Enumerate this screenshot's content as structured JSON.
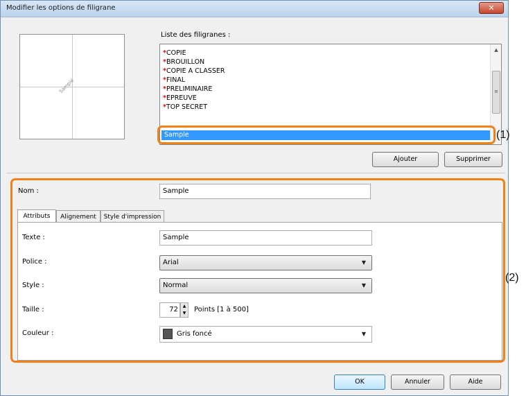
{
  "window": {
    "title": "Modifier les options de filigrane",
    "close_glyph": "✕"
  },
  "preview": {
    "watermark_text": "Sample"
  },
  "watermark_list": {
    "label": "Liste des filigranes :",
    "items": [
      {
        "marker": "*",
        "text": "COPIE"
      },
      {
        "marker": "*",
        "text": "BROUILLON"
      },
      {
        "marker": "*",
        "text": "COPIE A CLASSER"
      },
      {
        "marker": "*",
        "text": "FINAL"
      },
      {
        "marker": "*",
        "text": "PRELIMINAIRE"
      },
      {
        "marker": "*",
        "text": "EPREUVE"
      },
      {
        "marker": "*",
        "text": "TOP SECRET"
      }
    ],
    "selected": "Sample",
    "selection_color": "#3399ff",
    "marker_color": "#d0101c"
  },
  "buttons": {
    "add": "Ajouter",
    "delete": "Supprimer",
    "ok": "OK",
    "cancel": "Annuler",
    "help": "Aide"
  },
  "name_field": {
    "label": "Nom :",
    "value": "Sample"
  },
  "tabs": [
    {
      "label": "Attributs",
      "active": true
    },
    {
      "label": "Alignement",
      "active": false
    },
    {
      "label": "Style d'impression",
      "active": false
    }
  ],
  "attributes": {
    "text": {
      "label": "Texte :",
      "value": "Sample"
    },
    "font": {
      "label": "Police :",
      "value": "Arial"
    },
    "style": {
      "label": "Style :",
      "value": "Normal"
    },
    "size": {
      "label": "Taille :",
      "value": "72",
      "unit": "Points [1 à 500]"
    },
    "color": {
      "label": "Couleur :",
      "value": "Gris foncé",
      "swatch": "#555555"
    }
  },
  "callouts": {
    "one": "(1)",
    "two": "(2)",
    "color": "#f08018"
  },
  "icons": {
    "close": "close-icon",
    "scroll_up": "scroll-up-icon",
    "scroll_down": "scroll-down-icon",
    "dropdown": "chevron-down-icon",
    "spinner": "spinner-arrows-icon"
  }
}
